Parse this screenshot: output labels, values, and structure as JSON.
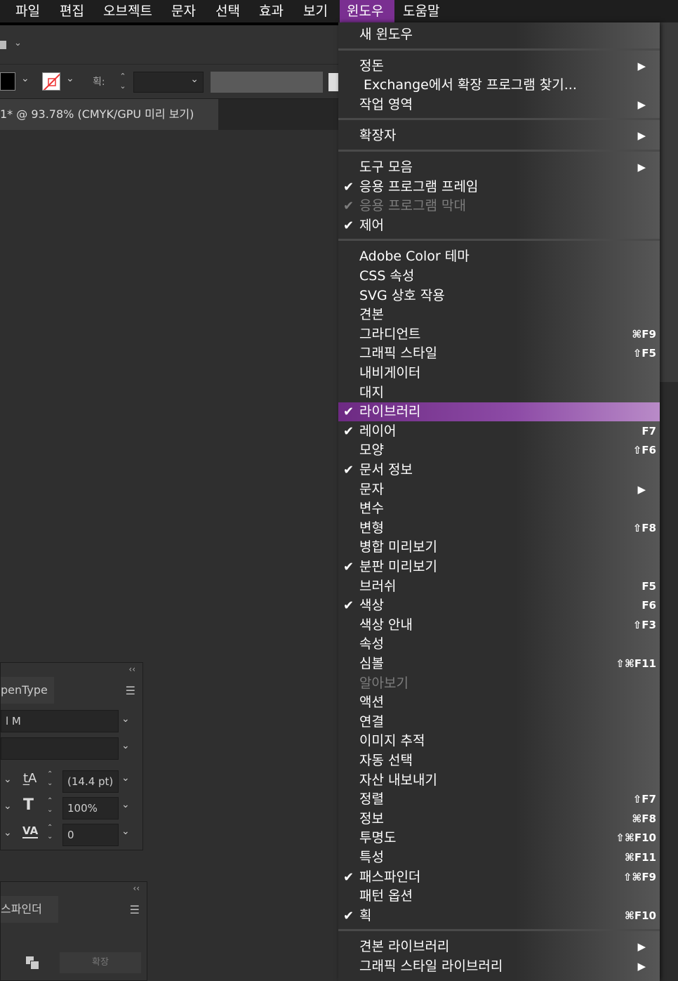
{
  "menubar": {
    "items": [
      {
        "label": "파일"
      },
      {
        "label": "편집"
      },
      {
        "label": "오브젝트"
      },
      {
        "label": "문자"
      },
      {
        "label": "선택"
      },
      {
        "label": "효과"
      },
      {
        "label": "보기"
      },
      {
        "label": "윈도우",
        "active": true
      },
      {
        "label": "도움말"
      }
    ],
    "active_color": "#7a2f91"
  },
  "toolbar": {
    "stroke_label": "획:"
  },
  "document": {
    "tab_title": "1* @ 93.78% (CMYK/GPU 미리 보기)"
  },
  "char_panel": {
    "tab_label": "penType",
    "font_field": "l M",
    "leading": "(14.4 pt)",
    "scale": "100%",
    "tracking": "0"
  },
  "pathfinder_panel": {
    "tab_label": "스파인더",
    "expand_button": "확장"
  },
  "window_menu": {
    "highlight_color": "#7a2f91",
    "items": [
      {
        "label": "새 윈도우"
      },
      {
        "sep": true
      },
      {
        "label": "정돈",
        "submenu": true
      },
      {
        "label": "Exchange에서 확장 프로그램 찾기..."
      },
      {
        "label": "작업 영역",
        "submenu": true
      },
      {
        "sep": true
      },
      {
        "label": "확장자",
        "submenu": true
      },
      {
        "sep": true
      },
      {
        "label": "도구 모음",
        "submenu": true
      },
      {
        "label": "응용 프로그램 프레임",
        "checked": true
      },
      {
        "label": "응용 프로그램 막대",
        "checked": true,
        "disabled": true
      },
      {
        "label": "제어",
        "checked": true
      },
      {
        "sep": true
      },
      {
        "label": "Adobe Color 테마"
      },
      {
        "label": "CSS 속성"
      },
      {
        "label": "SVG 상호 작용"
      },
      {
        "label": "견본"
      },
      {
        "label": "그라디언트",
        "shortcut": "⌘F9"
      },
      {
        "label": "그래픽 스타일",
        "shortcut": "⇧F5"
      },
      {
        "label": "내비게이터"
      },
      {
        "label": "대지"
      },
      {
        "label": "라이브러리",
        "checked": true,
        "highlight": true
      },
      {
        "label": "레이어",
        "checked": true,
        "shortcut": "F7"
      },
      {
        "label": "모양",
        "shortcut": "⇧F6"
      },
      {
        "label": "문서 정보",
        "checked": true
      },
      {
        "label": "문자",
        "submenu": true
      },
      {
        "label": "변수"
      },
      {
        "label": "변형",
        "shortcut": "⇧F8"
      },
      {
        "label": "병합 미리보기"
      },
      {
        "label": "분판 미리보기",
        "checked": true
      },
      {
        "label": "브러쉬",
        "shortcut": "F5"
      },
      {
        "label": "색상",
        "checked": true,
        "shortcut": "F6"
      },
      {
        "label": "색상 안내",
        "shortcut": "⇧F3"
      },
      {
        "label": "속성"
      },
      {
        "label": "심볼",
        "shortcut": "⇧⌘F11"
      },
      {
        "label": "알아보기",
        "disabled": true
      },
      {
        "label": "액션"
      },
      {
        "label": "연결"
      },
      {
        "label": "이미지 추적"
      },
      {
        "label": "자동 선택"
      },
      {
        "label": "자산 내보내기"
      },
      {
        "label": "정렬",
        "shortcut": "⇧F7"
      },
      {
        "label": "정보",
        "shortcut": "⌘F8"
      },
      {
        "label": "투명도",
        "shortcut": "⇧⌘F10"
      },
      {
        "label": "특성",
        "shortcut": "⌘F11"
      },
      {
        "label": "패스파인더",
        "checked": true,
        "shortcut": "⇧⌘F9"
      },
      {
        "label": "패턴 옵션"
      },
      {
        "label": "획",
        "checked": true,
        "shortcut": "⌘F10"
      },
      {
        "sep": true
      },
      {
        "label": "견본 라이브러리",
        "submenu": true
      },
      {
        "label": "그래픽 스타일 라이브러리",
        "submenu": true
      }
    ]
  }
}
